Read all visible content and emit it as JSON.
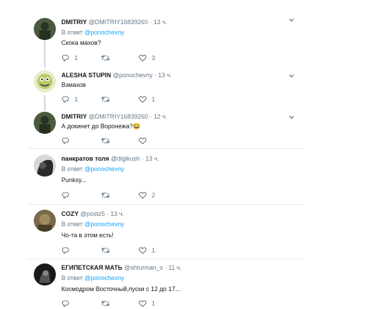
{
  "tweets": [
    {
      "name": "DMITRIY",
      "handle": "@DMITRIY16839260",
      "dot": "·",
      "time": "13 ч.",
      "reply_prefix": "В ответ",
      "reply_to": "@ponochevny",
      "text": "Скока махов?",
      "replies": "1",
      "retweets": "",
      "likes": "3"
    },
    {
      "name": "ALESHA STUPIN",
      "handle": "@ponochevny",
      "dot": "·",
      "time": "13 ч.",
      "reply_prefix": "",
      "reply_to": "",
      "text": "Взмахов",
      "replies": "1",
      "retweets": "",
      "likes": "1"
    },
    {
      "name": "DMITRIY",
      "handle": "@DMITRIY16839260",
      "dot": "·",
      "time": "12 ч.",
      "reply_prefix": "",
      "reply_to": "",
      "text": "А докинет до Воронежа?",
      "emoji": "😂",
      "replies": "",
      "retweets": "",
      "likes": ""
    },
    {
      "name": "панкратов толя",
      "handle": "@digikush",
      "dot": "·",
      "time": "13 ч.",
      "reply_prefix": "В ответ",
      "reply_to": "@ponochevny",
      "text": "Punksy...",
      "replies": "",
      "retweets": "",
      "likes": "2"
    },
    {
      "name": "COZY",
      "handle": "@postz5",
      "dot": "·",
      "time": "13 ч.",
      "reply_prefix": "В ответ",
      "reply_to": "@ponochevny",
      "text": "Чо-та в этом есть!",
      "replies": "",
      "retweets": "",
      "likes": "1"
    },
    {
      "name": "ЕГИПЕТСКАЯ МАТЬ",
      "handle": "@shturman_s",
      "dot": "·",
      "time": "11 ч.",
      "reply_prefix": "В ответ",
      "reply_to": "@ponochevny",
      "text": "Космодром Восточный,пуски с 12 до 17...",
      "replies": "",
      "retweets": "",
      "likes": "1"
    }
  ],
  "colors": {
    "name": "#14171a",
    "muted": "#657786",
    "link": "#1da1f2",
    "separator": "#e6ecf0",
    "thread": "#ccd6dd"
  },
  "icons": {
    "reply": "reply-icon",
    "retweet": "retweet-icon",
    "like": "heart-icon",
    "more": "chevron-down-icon"
  }
}
